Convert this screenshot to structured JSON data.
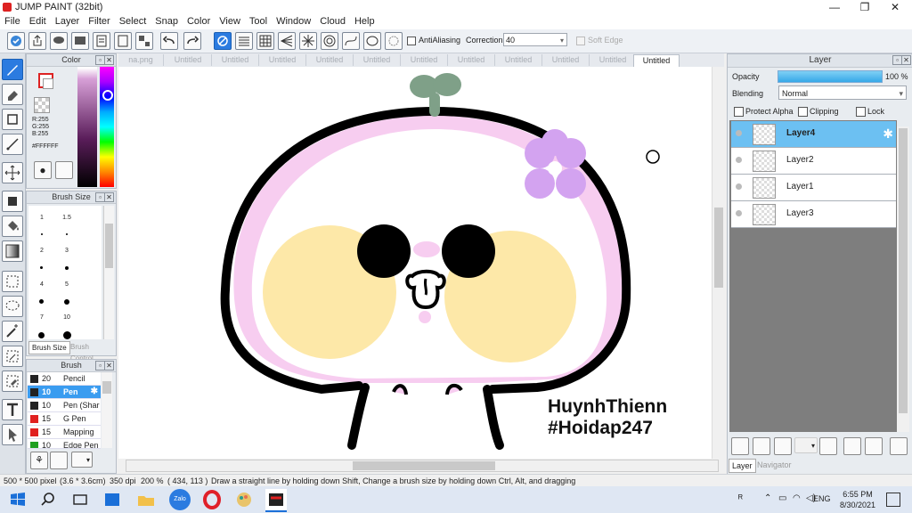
{
  "app": {
    "title": "JUMP PAINT (32bit)"
  },
  "window_controls": {
    "minimize": "—",
    "maximize": "❐",
    "close": "✕"
  },
  "menu": [
    "File",
    "Edit",
    "Layer",
    "Filter",
    "Select",
    "Snap",
    "Color",
    "View",
    "Tool",
    "Window",
    "Cloud",
    "Help"
  ],
  "toolbar": {
    "antialiasing_label": "AntiAliasing",
    "correction_label": "Correction",
    "correction_value": "40",
    "softedge_label": "Soft Edge"
  },
  "tabs": [
    "na.png",
    "Untitled",
    "Untitled",
    "Untitled",
    "Untitled",
    "Untitled",
    "Untitled",
    "Untitled",
    "Untitled",
    "Untitled",
    "Untitled",
    "Untitled"
  ],
  "color_panel": {
    "title": "Color",
    "r": "R:255",
    "g": "G:255",
    "b": "B:255",
    "hex": "#FFFFFF"
  },
  "brush_size_panel": {
    "title": "Brush Size",
    "sizes": [
      "1",
      "1.5",
      "2",
      "3",
      "4",
      "5",
      "7",
      "10"
    ],
    "tab_active": "Brush Size",
    "tab_inactive": "Brush Control"
  },
  "brush_panel": {
    "title": "Brush",
    "items": [
      {
        "size": "20",
        "name": "Pencil",
        "color": "#222222"
      },
      {
        "size": "10",
        "name": "Pen",
        "color": "#222222"
      },
      {
        "size": "10",
        "name": "Pen (Shar",
        "color": "#222222"
      },
      {
        "size": "15",
        "name": "G Pen",
        "color": "#e02020"
      },
      {
        "size": "15",
        "name": "Mapping P",
        "color": "#e02020"
      },
      {
        "size": "10",
        "name": "Edge Pen",
        "color": "#20a020"
      }
    ]
  },
  "layer_panel": {
    "title": "Layer",
    "opacity_label": "Opacity",
    "opacity_value": "100 %",
    "opacity_fraction": 1.0,
    "blending_label": "Blending",
    "blending_value": "Normal",
    "protect_alpha": "Protect Alpha",
    "clipping": "Clipping",
    "lock": "Lock",
    "layers": [
      "Layer4",
      "Layer2",
      "Layer1",
      "Layer3"
    ],
    "bottom_tabs": [
      "Layer",
      "Navigator"
    ]
  },
  "artwork": {
    "signature_line1": "HuynhThienn",
    "signature_line2": "#Hoidap247"
  },
  "status": {
    "size": "500 * 500 pixel",
    "cm": "(3.6 * 3.6cm)",
    "dpi": "350 dpi",
    "zoom": "200 %",
    "coords": "( 434, 113 )",
    "hint": "Draw a straight line by holding down Shift, Change a brush size by holding down Ctrl, Alt, and dragging"
  },
  "taskbar": {
    "lang": "ENG",
    "time": "6:55 PM",
    "date": "8/30/2021",
    "zalo": "Zalo"
  }
}
